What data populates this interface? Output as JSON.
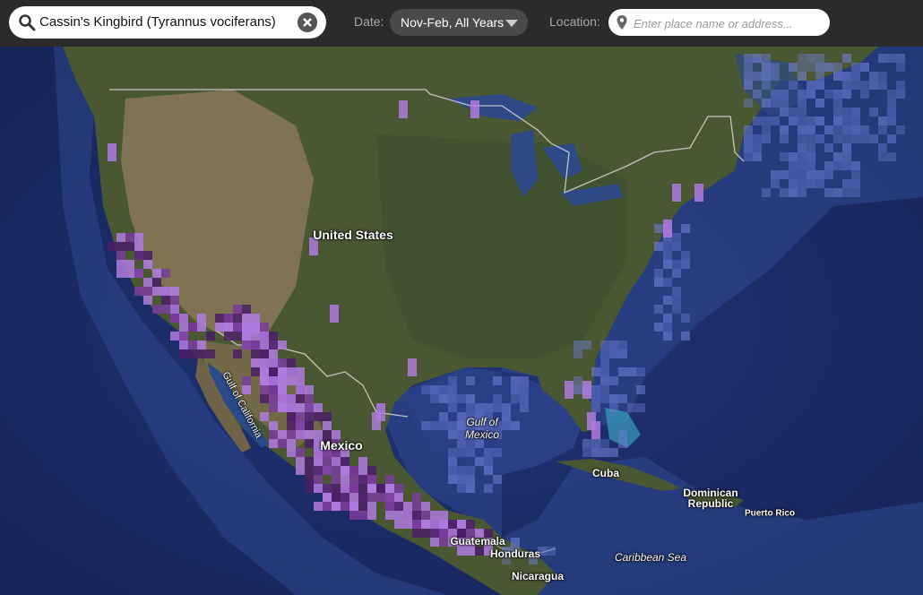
{
  "toolbar": {
    "species_search": {
      "value": "Cassin's Kingbird (Tyrannus vociferans)"
    },
    "date": {
      "label": "Date:",
      "value": "Nov-Feb, All Years"
    },
    "location": {
      "label": "Location:",
      "placeholder": "Enter place name or address..."
    }
  },
  "map": {
    "labels": {
      "united_states": "United States",
      "mexico": "Mexico",
      "gulf_of_mexico": "Gulf of Mexico",
      "gulf_of_california": "Gulf of California",
      "cuba": "Cuba",
      "dominican_republic": "Dominican Republic",
      "puerto_rico": "Puerto Rico",
      "guatemala": "Guatemala",
      "honduras": "Honduras",
      "nicaragua": "Nicaragua",
      "caribbean_sea": "Caribbean Sea"
    },
    "colors": {
      "ocean_deep": "#1a2a5e",
      "ocean_shelf": "#3a5a9c",
      "land": "#4d5a34",
      "desert": "#8a7a5c",
      "frequency_low": "#b07ae0",
      "frequency_high": "#4a1e66",
      "observed_absent": "#6f7dd6"
    }
  }
}
